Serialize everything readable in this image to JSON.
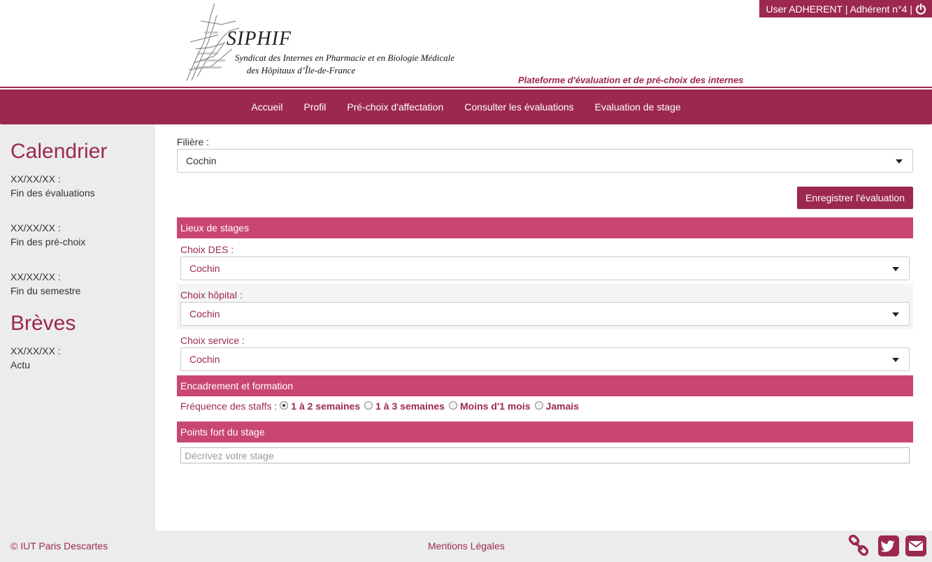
{
  "header": {
    "logo_title": "SIPHIF",
    "logo_line1": "Syndicat des Internes en Pharmacie et en Biologie Médicale",
    "logo_line2": "des Hôpitaux d’Île-de-France",
    "tagline": "Plateforme d'évaluation et de pré-choix des internes",
    "user_text": "User ADHERENT | Adhérent n°4 |"
  },
  "nav": {
    "items": [
      "Accueil",
      "Profil",
      "Pré-choix d'affectation",
      "Consulter les évaluations",
      "Evaluation de stage"
    ]
  },
  "sidebar": {
    "calendar_title": "Calendrier",
    "calendar_items": [
      {
        "date": "XX/XX/XX :",
        "text": "Fin des évaluations"
      },
      {
        "date": "XX/XX/XX :",
        "text": "Fin des pré-choix"
      },
      {
        "date": "XX/XX/XX :",
        "text": "Fin du semestre"
      }
    ],
    "news_title": "Brèves",
    "news_items": [
      {
        "date": "XX/XX/XX :",
        "text": "Actu"
      }
    ]
  },
  "form": {
    "filiere_label": "Filière :",
    "filiere_value": "Cochin",
    "save_button": "Enregistrer l'évaluation",
    "section_lieux": "Lieux de stages",
    "des_label": "Choix DES :",
    "des_value": "Cochin",
    "hopital_label": "Choix hôpital :",
    "hopital_value": "Cochin",
    "service_label": "Choix service :",
    "service_value": "Cochin",
    "section_encadrement": "Encadrement et formation",
    "staffs_label": "Fréquence des staffs :",
    "staffs_options": [
      "1 à 2 semaines",
      "1 à 3 semaines",
      "Moins d'1 mois",
      "Jamais"
    ],
    "staffs_selected": "1 à 2 semaines",
    "section_points": "Points fort du stage",
    "points_placeholder": "Décrivez votre stage"
  },
  "footer": {
    "copyright": "© IUT Paris Descartes",
    "legal": "Mentions Légales"
  },
  "colors": {
    "brand": "#9c2852",
    "section": "#c94673",
    "sidebar_bg": "#ececec"
  }
}
